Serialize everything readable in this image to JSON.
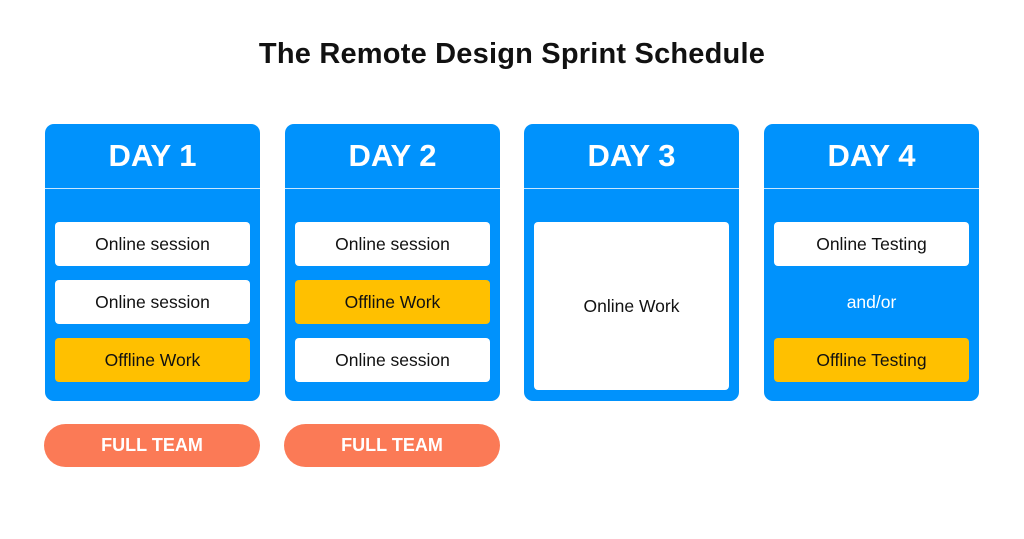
{
  "title": "The Remote Design Sprint Schedule",
  "colors": {
    "card": "#0092fc",
    "online": "#ffffff",
    "offline": "#ffc000",
    "pill": "#fb7a56"
  },
  "days": [
    {
      "label": "DAY 1",
      "items": [
        {
          "text": "Online session",
          "type": "online"
        },
        {
          "text": "Online session",
          "type": "online"
        },
        {
          "text": "Offline Work",
          "type": "offline"
        }
      ],
      "badge": "FULL TEAM"
    },
    {
      "label": "DAY 2",
      "items": [
        {
          "text": "Online session",
          "type": "online"
        },
        {
          "text": "Offline Work",
          "type": "offline"
        },
        {
          "text": "Online session",
          "type": "online"
        }
      ],
      "badge": "FULL TEAM"
    },
    {
      "label": "DAY 3",
      "items": [
        {
          "text": "Online Work",
          "type": "online"
        }
      ]
    },
    {
      "label": "DAY 4",
      "items": [
        {
          "text": "Online Testing",
          "type": "online"
        },
        {
          "text": "and/or",
          "type": "connector"
        },
        {
          "text": "Offline Testing",
          "type": "offline"
        }
      ]
    }
  ]
}
